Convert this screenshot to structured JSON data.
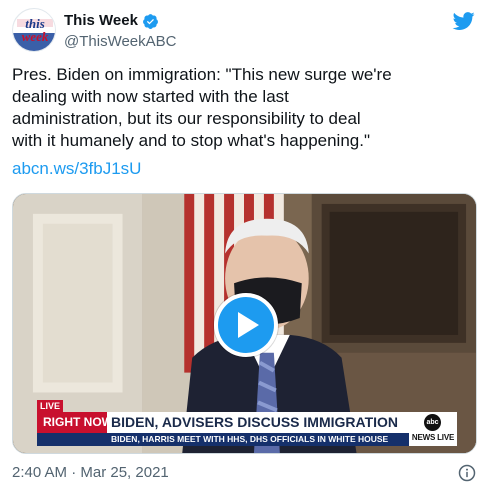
{
  "account": {
    "display_name": "This Week",
    "handle": "@ThisWeekABC",
    "avatar_text_top": "this",
    "avatar_text_bottom": "week"
  },
  "tweet": {
    "text": "Pres. Biden on immigration: \"This new surge we're\ndealing with now started with the last\nadministration, but its our responsibility to deal\nwith it humanely and to stop what's happening.\"",
    "link": "abcn.ws/3fbJ1sU",
    "timestamp": "2:40 AM · Mar 25, 2021"
  },
  "video": {
    "live_label": "LIVE",
    "right_now_label": "RIGHT NOW",
    "headline": "BIDEN, ADVISERS DISCUSS IMMIGRATION",
    "subheadline": "BIDEN, HARRIS MEET WITH HHS, DHS OFFICIALS IN WHITE HOUSE",
    "network_logo_text": "abc",
    "network_label": "NEWS LIVE"
  },
  "icons": {
    "verified": "verified-badge-icon",
    "platform": "twitter-bird-icon",
    "play": "play-icon",
    "info": "info-icon"
  },
  "colors": {
    "accent": "#1d9bf0",
    "text": "#0f1419",
    "muted": "#536471",
    "banner_red": "#c8102e",
    "banner_navy": "#15306b"
  }
}
